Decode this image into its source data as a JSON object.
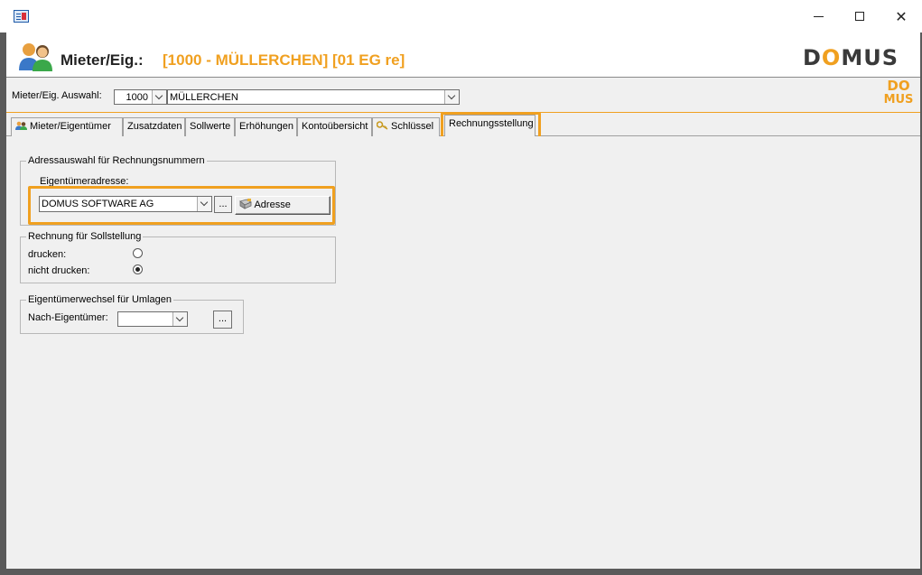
{
  "window": {
    "minimize_icon": "minimize-icon",
    "maximize_icon": "maximize-icon",
    "close_icon": "close-icon",
    "close_glyph": "✕"
  },
  "header": {
    "title": "Mieter/Eig.:",
    "subtitle": "[1000 - MÜLLERCHEN] [01 EG re]",
    "logo_text_d": "D",
    "logo_text_o": "O",
    "logo_text_rest": "MUS",
    "accent_color": "#f0a020"
  },
  "selection": {
    "label": "Mieter/Eig. Auswahl:",
    "number_value": "1000",
    "name_value": "MÜLLERCHEN",
    "mini_logo_line1": "DO",
    "mini_logo_line2": "MUS"
  },
  "tabs": [
    {
      "label": "Mieter/Eigentümer",
      "icon": "users-icon"
    },
    {
      "label": "Zusatzdaten"
    },
    {
      "label": "Sollwerte"
    },
    {
      "label": "Erhöhungen"
    },
    {
      "label": "Kontoübersicht"
    },
    {
      "label": "Schlüssel",
      "icon": "key-icon"
    },
    {
      "label": "Rechnungsstellung",
      "active": true
    }
  ],
  "address_group": {
    "title": "Adressauswahl für Rechnungsnummern",
    "field_label": "Eigentümeradresse:",
    "field_value": "DOMUS SOFTWARE AG",
    "dots_label": "...",
    "address_button_label": "Adresse"
  },
  "invoice_group": {
    "title": "Rechnung für Sollstellung",
    "option_print": "drucken:",
    "option_no_print": "nicht drucken:",
    "selected": "nicht drucken:"
  },
  "owner_change_group": {
    "title": "Eigentümerwechsel für Umlagen",
    "field_label": "Nach-Eigentümer:",
    "field_value": "",
    "dots_label": "..."
  }
}
